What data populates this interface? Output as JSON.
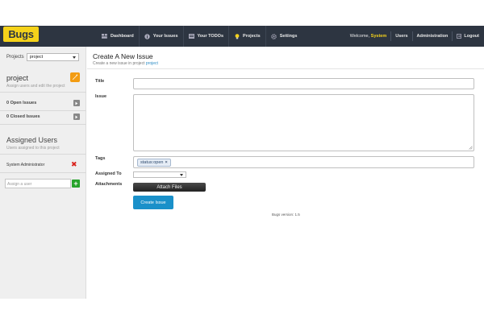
{
  "app": {
    "logo": "Bugs"
  },
  "nav": {
    "items": [
      {
        "label": "Dashboard",
        "icon": "dashboard-icon"
      },
      {
        "label": "Your Issues",
        "icon": "info-icon"
      },
      {
        "label": "Your TODOs",
        "icon": "todo-icon"
      },
      {
        "label": "Projects",
        "icon": "lightbulb-icon"
      },
      {
        "label": "Settings",
        "icon": "gear-icon"
      }
    ],
    "welcome_prefix": "Welcome,",
    "welcome_user": "System",
    "users": "Users",
    "administration": "Administration",
    "logout": "Logout"
  },
  "sidebar": {
    "projects_label": "Projects",
    "selected_project": "project",
    "project_title": "project",
    "project_sub": "Assign users and edit the project",
    "open_issues": "0 Open Issues",
    "closed_issues": "0 Closed Issues",
    "assigned_title": "Assigned Users",
    "assigned_sub": "Users assigned to this project",
    "assigned_user": "System Administrator",
    "assign_placeholder": "Assign a user"
  },
  "main": {
    "title": "Create A New Issue",
    "subtitle_prefix": "Create a new issue in project",
    "subtitle_link": "project",
    "labels": {
      "title": "Title",
      "issue": "Issue",
      "tags": "Tags",
      "assigned_to": "Assigned To",
      "attachments": "Attachments"
    },
    "tag_value": "status:open",
    "tag_remove": "×",
    "attach_button": "Attach Files",
    "create_button": "Create Issue",
    "version": "Bugs version: 1.5"
  },
  "colors": {
    "topbar": "#2d3541",
    "logo_bg": "#f5d21a",
    "accent_user": "#f5d21a",
    "primary_button": "#1a90c9",
    "edit_button": "#f39c12",
    "add_button": "#27a32b",
    "remove": "#d9231d"
  }
}
